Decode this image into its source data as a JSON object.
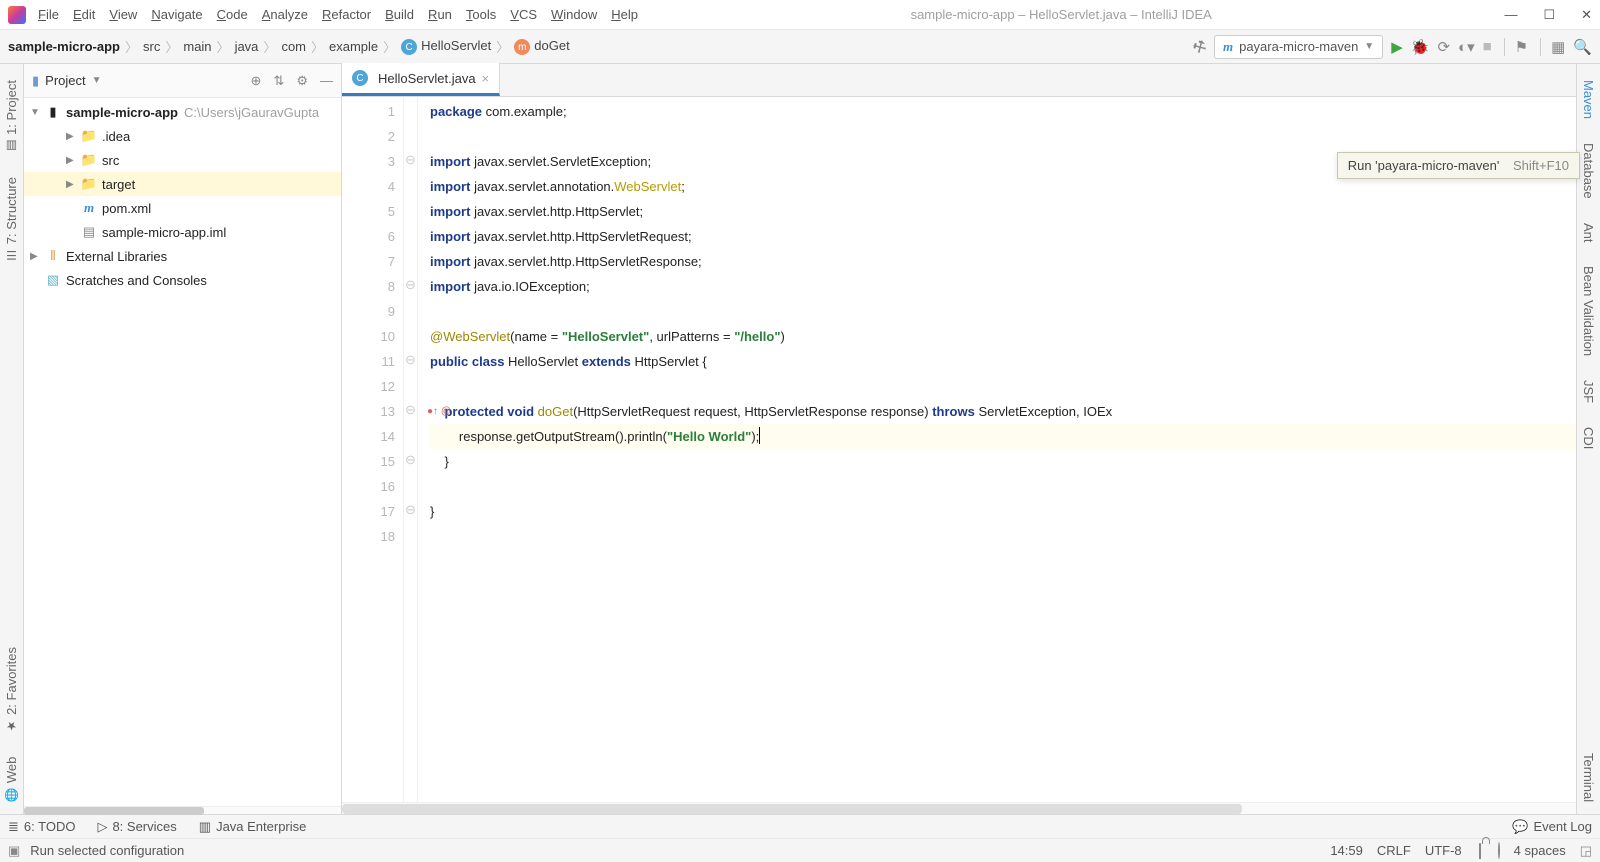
{
  "title": "sample-micro-app – HelloServlet.java – IntelliJ IDEA",
  "menu": [
    "File",
    "Edit",
    "View",
    "Navigate",
    "Code",
    "Analyze",
    "Refactor",
    "Build",
    "Run",
    "Tools",
    "VCS",
    "Window",
    "Help"
  ],
  "breadcrumb": {
    "project": "sample-micro-app",
    "p1": "src",
    "p2": "main",
    "p3": "java",
    "p4": "com",
    "p5": "example",
    "class": "HelloServlet",
    "method": "doGet"
  },
  "runConfig": {
    "label": "payara-micro-maven"
  },
  "tooltip": {
    "text": "Run 'payara-micro-maven'",
    "shortcut": "Shift+F10"
  },
  "leftStrip": {
    "project": "1: Project",
    "structure": "7: Structure",
    "favorites": "2: Favorites",
    "web": "Web"
  },
  "rightStrip": {
    "maven": "Maven",
    "database": "Database",
    "ant": "Ant",
    "bean": "Bean Validation",
    "jsf": "JSF",
    "cdi": "CDI",
    "terminal": "Terminal"
  },
  "projectPanel": {
    "title": "Project",
    "root": {
      "label": "sample-micro-app",
      "path": "C:\\Users\\jGauravGupta"
    },
    "tree": [
      {
        "label": ".idea",
        "depth": 1,
        "kind": "folder-gray",
        "exp": "▶"
      },
      {
        "label": "src",
        "depth": 1,
        "kind": "folder-gray",
        "exp": "▶"
      },
      {
        "label": "target",
        "depth": 1,
        "kind": "folder-orange",
        "exp": "▶",
        "selected": true
      },
      {
        "label": "pom.xml",
        "depth": 1,
        "kind": "file-m",
        "exp": ""
      },
      {
        "label": "sample-micro-app.iml",
        "depth": 1,
        "kind": "file",
        "exp": ""
      }
    ],
    "externals": "External Libraries",
    "scratches": "Scratches and Consoles"
  },
  "tab": {
    "label": "HelloServlet.java"
  },
  "code": {
    "lines": [
      {
        "n": 1,
        "html": "<span class='kw'>package</span> com.example;"
      },
      {
        "n": 2,
        "html": ""
      },
      {
        "n": 3,
        "html": "<span class='kw'>import</span> javax.servlet.ServletException;"
      },
      {
        "n": 4,
        "html": "<span class='kw'>import</span> javax.servlet.annotation.<span class='cls'>WebServlet</span>;"
      },
      {
        "n": 5,
        "html": "<span class='kw'>import</span> javax.servlet.http.HttpServlet;"
      },
      {
        "n": 6,
        "html": "<span class='kw'>import</span> javax.servlet.http.HttpServletRequest;"
      },
      {
        "n": 7,
        "html": "<span class='kw'>import</span> javax.servlet.http.HttpServletResponse;"
      },
      {
        "n": 8,
        "html": "<span class='kw'>import</span> java.io.IOException;"
      },
      {
        "n": 9,
        "html": ""
      },
      {
        "n": 10,
        "html": "<span class='ann'>@WebServlet</span>(name = <span class='str'>\"HelloServlet\"</span>, urlPatterns = <span class='str'>\"/hello\"</span>)"
      },
      {
        "n": 11,
        "html": "<span class='kw'>public class</span> HelloServlet <span class='kw'>extends</span> HttpServlet {"
      },
      {
        "n": 12,
        "html": ""
      },
      {
        "n": 13,
        "html": "    <span class='kw'>protected void</span> <span class='ann'>doGet</span>(HttpServletRequest request, HttpServletResponse response) <span class='kw'>throws</span> ServletException, IOEx",
        "mark": "●↑ @"
      },
      {
        "n": 14,
        "html": "        response.getOutputStream().println(<span class='str'>\"Hello World\"</span>);<span class='caret'></span>",
        "current": true
      },
      {
        "n": 15,
        "html": "    }"
      },
      {
        "n": 16,
        "html": ""
      },
      {
        "n": 17,
        "html": "}"
      },
      {
        "n": 18,
        "html": ""
      }
    ]
  },
  "bottomTools": {
    "todo": "6: TODO",
    "services": "8: Services",
    "java": "Java Enterprise",
    "eventLog": "Event Log"
  },
  "status": {
    "msg": "Run selected configuration",
    "time": "14:59",
    "sep": "CRLF",
    "enc": "UTF-8",
    "indent": "4 spaces"
  }
}
